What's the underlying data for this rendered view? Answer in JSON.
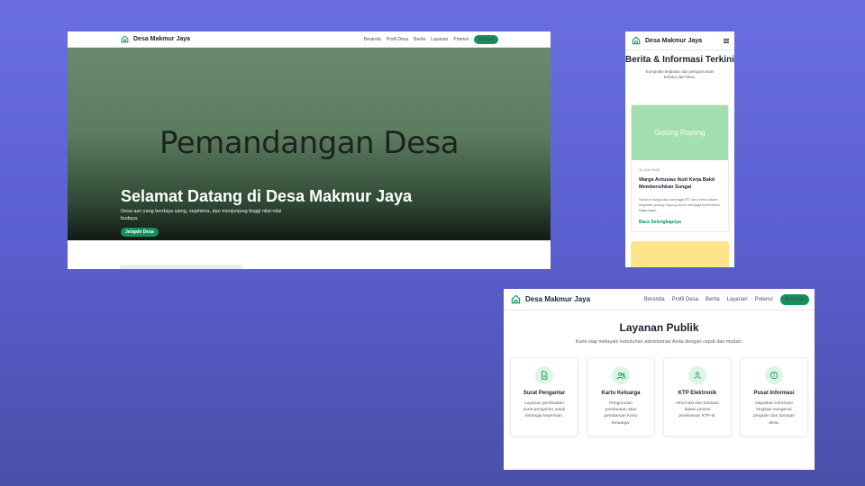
{
  "site": {
    "brand": "Desa Makmur Jaya",
    "nav": [
      "Beranda",
      "Profil Desa",
      "Berita",
      "Layanan",
      "Potensi"
    ],
    "cta": "Kontak"
  },
  "hero": {
    "image_text": "Pemandangan Desa",
    "title": "Selamat Datang di Desa Makmur Jaya",
    "subtitle": "Desa asri yang berdaya saing, sejahtera, dan menjunjung tinggi nilai-nilai budaya.",
    "button": "Jelajahi Desa"
  },
  "news": {
    "title": "Berita & Informasi Terkini",
    "subtitle": "Kumpulan kegiatan dan pengumuman terbaru dari desa.",
    "card": {
      "thumb_text": "Gotong Royong",
      "date": "10 Juni 2025",
      "headline": "Warga Antusias Ikuti Kerja Bakti Membersihkan Sungai",
      "excerpt": "Seluruh warga dari berbagai RT turut serta dalam kegiatan gotong royong untuk menjaga kebersihan lingkungan...",
      "link": "Baca Selengkapnya"
    }
  },
  "services": {
    "title": "Layanan Publik",
    "subtitle": "Kami siap melayani kebutuhan administrasi Anda dengan cepat dan mudah.",
    "items": [
      {
        "name": "Surat Pengantar",
        "desc": "Layanan pembuatan surat pengantar untuk berbagai keperluan.",
        "icon": "document-icon"
      },
      {
        "name": "Kartu Keluarga",
        "desc": "Pengurusan pembuatan atau pembaruan Kartu Keluarga.",
        "icon": "users-icon"
      },
      {
        "name": "KTP Elektronik",
        "desc": "Informasi dan bantuan dalam proses perekaman KTP-el.",
        "icon": "user-icon"
      },
      {
        "name": "Pusat Informasi",
        "desc": "Dapatkan informasi lengkap mengenai program dan bantuan desa.",
        "icon": "info-icon"
      }
    ]
  },
  "colors": {
    "accent": "#14905a",
    "background": "#5a5fcf"
  }
}
